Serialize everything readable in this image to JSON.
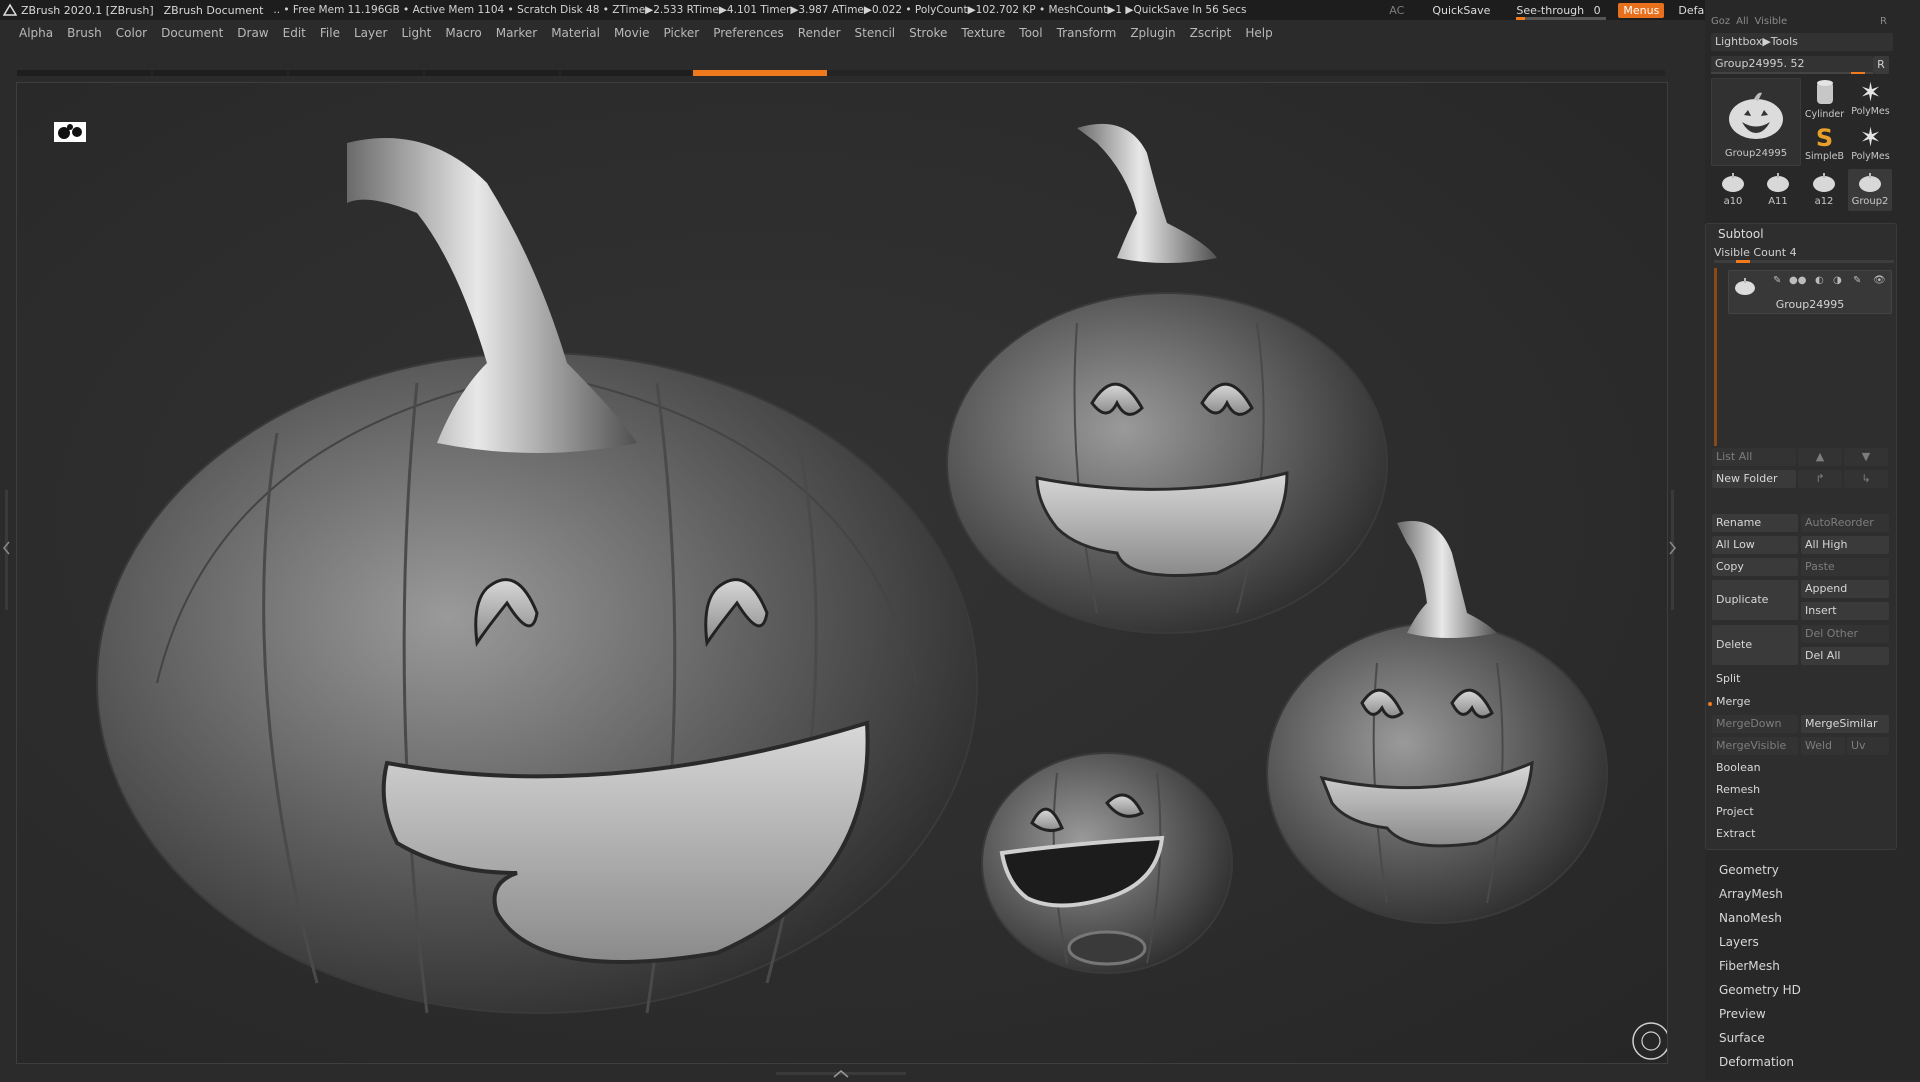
{
  "titlebar": {
    "app_title": "ZBrush 2020.1 [ZBrush]",
    "document": "ZBrush Document",
    "stats": ".. • Free Mem 11.196GB • Active Mem 1104 • Scratch Disk 48 • ZTime▶2.533 RTime▶4.101 Timer▶3.987 ATime▶0.022 • PolyCount▶102.702 KP • MeshCount▶1 ▶QuickSave In 56 Secs",
    "ac": "AC",
    "quicksave": "QuickSave",
    "see_through_label": "See-through",
    "see_through_value": "0",
    "see_through_fill": 0.1,
    "menus": "Menus",
    "default_script": "DefaultZScript",
    "accent_color": "#E8701C"
  },
  "menubar": [
    "Alpha",
    "Brush",
    "Color",
    "Document",
    "Draw",
    "Edit",
    "File",
    "Layer",
    "Light",
    "Macro",
    "Marker",
    "Material",
    "Movie",
    "Picker",
    "Preferences",
    "Render",
    "Stencil",
    "Stroke",
    "Texture",
    "Tool",
    "Transform",
    "Zplugin",
    "Zscript",
    "Help"
  ],
  "tool_palette": {
    "top_stub": [
      "Goz",
      "All",
      "Visible",
      "R"
    ],
    "lightbox_tools": "Lightbox▶Tools",
    "current_tool_slider": "Group24995. 52",
    "r_button": "R",
    "thumbnails": [
      {
        "name": "Group24995",
        "icon": "pumpkin-icon"
      },
      {
        "name": "Cylinder",
        "icon": "cylinder-icon"
      },
      {
        "name": "PolyMes",
        "icon": "polymesh-star-icon"
      },
      {
        "name": "SimpleB",
        "icon": "simplebrush-icon"
      },
      {
        "name": "PolyMes",
        "icon": "polymesh-star-icon"
      },
      {
        "name": "a10",
        "icon": "pumpkin-icon"
      },
      {
        "name": "A11",
        "icon": "pumpkin-icon"
      },
      {
        "name": "a12",
        "icon": "pumpkin-icon"
      },
      {
        "name": "Group2",
        "icon": "pumpkin-icon"
      }
    ]
  },
  "subtool": {
    "title": "Subtool",
    "visible_count": "Visible Count 4",
    "item_name": "Group24995",
    "list_all": "List All",
    "new_folder": "New Folder",
    "rename": "Rename",
    "auto_reorder": "AutoReorder",
    "all_low": "All Low",
    "all_high": "All High",
    "copy": "Copy",
    "paste": "Paste",
    "duplicate": "Duplicate",
    "append": "Append",
    "insert": "Insert",
    "delete": "Delete",
    "del_other": "Del Other",
    "del_all": "Del All",
    "split": "Split",
    "merge": "Merge",
    "merge_down": "MergeDown",
    "merge_similar": "MergeSimilar",
    "merge_visible": "MergeVisible",
    "weld": "Weld",
    "uv": "Uv",
    "boolean": "Boolean",
    "remesh": "Remesh",
    "project": "Project",
    "extract": "Extract"
  },
  "tool_subpalettes": [
    "Geometry",
    "ArrayMesh",
    "NanoMesh",
    "Layers",
    "FiberMesh",
    "Geometry HD",
    "Preview",
    "Surface",
    "Deformation"
  ]
}
